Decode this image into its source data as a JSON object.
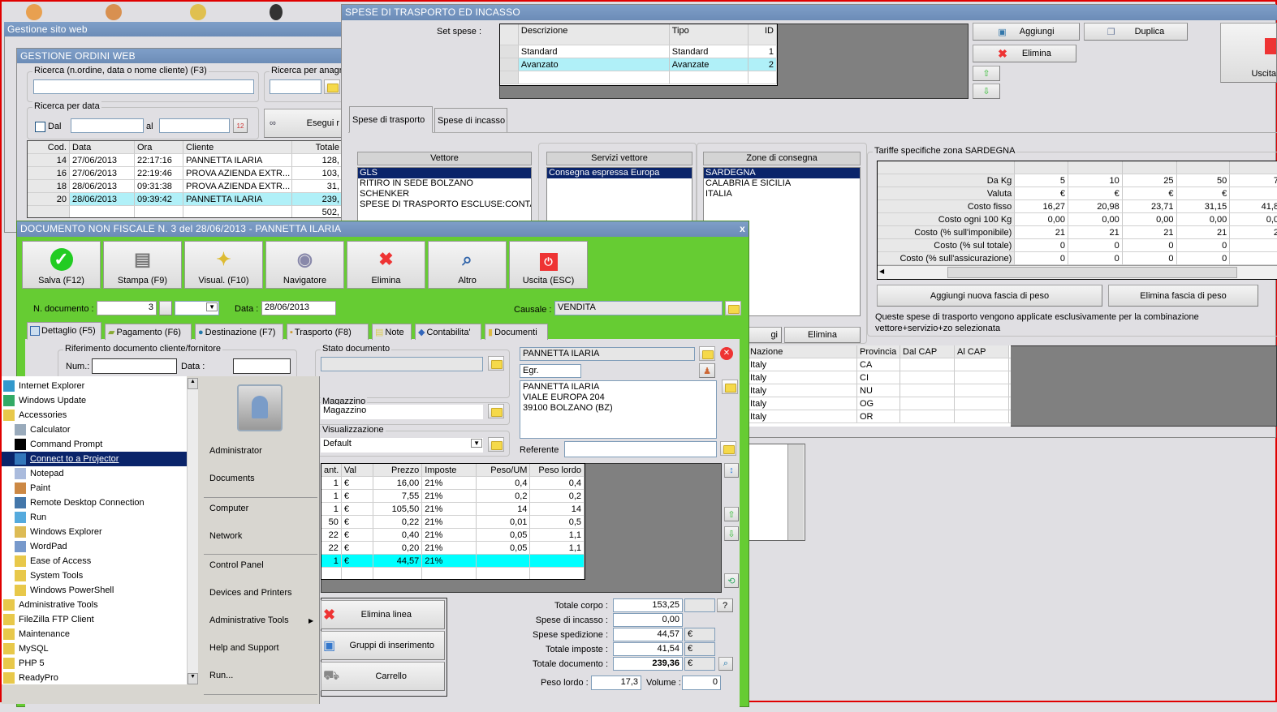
{
  "desktop": {
    "icons": [
      "users-icon",
      "users-icon",
      "users-icon",
      "agent-icon"
    ]
  },
  "site_window": {
    "title": "Gestione sito web"
  },
  "orders_window": {
    "title": "GESTIONE ORDINI WEB",
    "search_label": "Ricerca (n.ordine, data o nome cliente) (F3)",
    "search_value": "",
    "registry_label": "Ricerca per anagra",
    "date_group": "Ricerca per data",
    "from_label": "Dal",
    "to_label": "al",
    "run_button": "Esegui r",
    "columns": [
      "Cod.",
      "Data",
      "Ora",
      "Cliente",
      "Totale"
    ],
    "rows": [
      [
        "14",
        "27/06/2013",
        "22:17:16",
        "PANNETTA  ILARIA",
        "128,"
      ],
      [
        "16",
        "27/06/2013",
        "22:19:46",
        "PROVA AZIENDA EXTR...",
        "103,"
      ],
      [
        "18",
        "28/06/2013",
        "09:31:38",
        "PROVA AZIENDA EXTR...",
        "31,"
      ],
      [
        "20",
        "28/06/2013",
        "09:39:42",
        "PANNETTA  ILARIA",
        "239,"
      ],
      [
        "",
        "",
        "",
        "",
        "502,"
      ]
    ],
    "selected_row": 3
  },
  "shipping_window": {
    "title": "SPESE DI TRASPORTO ED INCASSO",
    "set_label": "Set spese :",
    "set_columns": [
      "Descrizione",
      "Tipo",
      "ID"
    ],
    "set_rows": [
      [
        "Standard",
        "Standard",
        "1"
      ],
      [
        "Avanzato",
        "Avanzate",
        "2"
      ],
      [
        "",
        "",
        ""
      ]
    ],
    "buttons": {
      "add": "Aggiungi",
      "duplicate": "Duplica",
      "delete": "Elimina",
      "exit": "Uscita"
    },
    "tabs": [
      "Spese di trasporto",
      "Spese di incasso"
    ],
    "carrier_header": "Vettore",
    "carriers": [
      "GLS",
      "RITIRO IN SEDE BOLZANO",
      "SCHENKER",
      "SPESE DI TRASPORTO ESCLUSE:CONTATTA"
    ],
    "services_header": "Servizi vettore",
    "services": [
      "Consegna espressa Europa"
    ],
    "zones_header": "Zone di consegna",
    "zones": [
      "SARDEGNA",
      "CALABRIA E SICILIA",
      "ITALIA"
    ],
    "zone_buttons": [
      "gi",
      "Elimina"
    ],
    "rates_title": "Tariffe specifiche zona SARDEGNA",
    "rates": [
      [
        "Da Kg",
        "5",
        "10",
        "25",
        "50",
        "7"
      ],
      [
        "Valuta",
        "€",
        "€",
        "€",
        "€",
        ""
      ],
      [
        "Costo fisso",
        "16,27",
        "20,98",
        "23,71",
        "31,15",
        "41,8"
      ],
      [
        "Costo ogni 100 Kg",
        "0,00",
        "0,00",
        "0,00",
        "0,00",
        "0,0"
      ],
      [
        "Costo (% sull'imponibile)",
        "21",
        "21",
        "21",
        "21",
        "2"
      ],
      [
        "Costo (% sul totale)",
        "0",
        "0",
        "0",
        "0",
        ""
      ],
      [
        "Costo (% sull'assicurazione)",
        "0",
        "0",
        "0",
        "0",
        ""
      ]
    ],
    "add_band": "Aggiungi nuova fascia di peso",
    "delete_band": "Elimina fascia di peso",
    "note": "Queste spese di trasporto vengono applicate esclusivamente per la combinazione vettore+servizio+zo selezionata",
    "zone_columns": [
      "Nazione",
      "Provincia",
      "Dal CAP",
      "Al CAP"
    ],
    "zone_rows": [
      [
        "Italy",
        "CA",
        "",
        ""
      ],
      [
        "Italy",
        "CI",
        "",
        ""
      ],
      [
        "Italy",
        "NU",
        "",
        ""
      ],
      [
        "Italy",
        "OG",
        "",
        ""
      ],
      [
        "Italy",
        "OR",
        "",
        ""
      ]
    ]
  },
  "doc_window": {
    "title": "DOCUMENTO NON FISCALE N. 3 del 28/06/2013 - PANNETTA  ILARIA",
    "close": "x",
    "toolbar": [
      "Salva (F12)",
      "Stampa (F9)",
      "Visual. (F10)",
      "Navigatore",
      "Elimina",
      "Altro",
      "Uscita (ESC)"
    ],
    "doc_no_label": "N. documento :",
    "doc_no": "3",
    "date_label": "Data :",
    "date": "28/06/2013",
    "reason_label": "Causale :",
    "reason": "VENDITA",
    "tabs": [
      "Dettaglio (F5)",
      "Pagamento (F6)",
      "Destinazione (F7)",
      "Trasporto (F8)",
      "Note",
      "Contabilita'",
      "Documenti"
    ],
    "ref_group": "Riferimento documento cliente/fornitore",
    "num_label": "Num.:",
    "ref_date_label": "Data :",
    "status_group": "Stato documento",
    "status": "",
    "warehouse_group": "Magazzino",
    "warehouse": "Magazzino",
    "view_group": "Visualizzazione",
    "view": "Default",
    "customer": "PANNETTA  ILARIA",
    "title_value": "Egr.",
    "address": [
      "PANNETTA  ILARIA",
      "VIALE EUROPA  204",
      "39100 BOLZANO (BZ)"
    ],
    "contact_label": "Referente",
    "contact": "",
    "item_columns": [
      "ant.",
      "Val",
      "Prezzo",
      "Imposte",
      "Peso/UM",
      "Peso lordo"
    ],
    "items": [
      [
        "1",
        "€",
        "16,00",
        "21%",
        "0,4",
        "0,4"
      ],
      [
        "1",
        "€",
        "7,55",
        "21%",
        "0,2",
        "0,2"
      ],
      [
        "1",
        "€",
        "105,50",
        "21%",
        "14",
        "14"
      ],
      [
        "50",
        "€",
        "0,22",
        "21%",
        "0,01",
        "0,5"
      ],
      [
        "22",
        "€",
        "0,40",
        "21%",
        "0,05",
        "1,1"
      ],
      [
        "22",
        "€",
        "0,20",
        "21%",
        "0,05",
        "1,1"
      ],
      [
        "1",
        "€",
        "44,57",
        "21%",
        "",
        ""
      ],
      [
        "",
        "",
        "",
        "",
        "",
        ""
      ]
    ],
    "highlighted_item": 6,
    "line_buttons": [
      "Elimina linea",
      "Gruppi di inserimento",
      "Carrello"
    ],
    "totals": [
      {
        "label": "Totale corpo :",
        "value": "153,25",
        "cur": ""
      },
      {
        "label": "Spese di incasso :",
        "value": "0,00",
        "cur": ""
      },
      {
        "label": "Spese spedizione :",
        "value": "44,57",
        "cur": "€"
      },
      {
        "label": "Totale imposte :",
        "value": "41,54",
        "cur": "€"
      },
      {
        "label": "Totale documento :",
        "value": "239,36",
        "cur": "€"
      }
    ],
    "help": "?",
    "gross_label": "Peso lordo :",
    "gross": "17,3",
    "volume_label": "Volume :",
    "volume": "0"
  },
  "start_menu": {
    "programs": [
      {
        "label": "Internet Explorer",
        "indent": 0,
        "icon": "ie-icon"
      },
      {
        "label": "Windows Update",
        "indent": 0,
        "icon": "update-icon"
      },
      {
        "label": "Accessories",
        "indent": 0,
        "icon": "folder-icon"
      },
      {
        "label": "Calculator",
        "indent": 1,
        "icon": "calculator-icon"
      },
      {
        "label": "Command Prompt",
        "indent": 1,
        "icon": "cmd-icon"
      },
      {
        "label": "Connect to a Projector",
        "indent": 1,
        "icon": "projector-icon"
      },
      {
        "label": "Notepad",
        "indent": 1,
        "icon": "notepad-icon"
      },
      {
        "label": "Paint",
        "indent": 1,
        "icon": "paint-icon"
      },
      {
        "label": "Remote Desktop Connection",
        "indent": 1,
        "icon": "rdp-icon"
      },
      {
        "label": "Run",
        "indent": 1,
        "icon": "run-icon"
      },
      {
        "label": "Windows Explorer",
        "indent": 1,
        "icon": "explorer-icon"
      },
      {
        "label": "WordPad",
        "indent": 1,
        "icon": "wordpad-icon"
      },
      {
        "label": "Ease of Access",
        "indent": 1,
        "icon": "folder-icon"
      },
      {
        "label": "System Tools",
        "indent": 1,
        "icon": "folder-icon"
      },
      {
        "label": "Windows PowerShell",
        "indent": 1,
        "icon": "folder-icon"
      },
      {
        "label": "Administrative Tools",
        "indent": 0,
        "icon": "folder-icon"
      },
      {
        "label": "FileZilla FTP Client",
        "indent": 0,
        "icon": "folder-icon"
      },
      {
        "label": "Maintenance",
        "indent": 0,
        "icon": "folder-icon"
      },
      {
        "label": "MySQL",
        "indent": 0,
        "icon": "folder-icon"
      },
      {
        "label": "PHP 5",
        "indent": 0,
        "icon": "folder-icon"
      },
      {
        "label": "ReadyPro",
        "indent": 0,
        "icon": "folder-icon"
      }
    ],
    "selected": 5,
    "right": [
      "Administrator",
      "Documents",
      "Computer",
      "Network",
      "Control Panel",
      "Devices and Printers",
      "Administrative Tools",
      "Help and Support",
      "Run..."
    ]
  },
  "colors": {
    "doc_green": "#66cc33",
    "title_blue": "#7596c2",
    "selection": "#0a246a",
    "highlight_row": "#b0f0f8",
    "cyan_row": "#00ffff"
  }
}
